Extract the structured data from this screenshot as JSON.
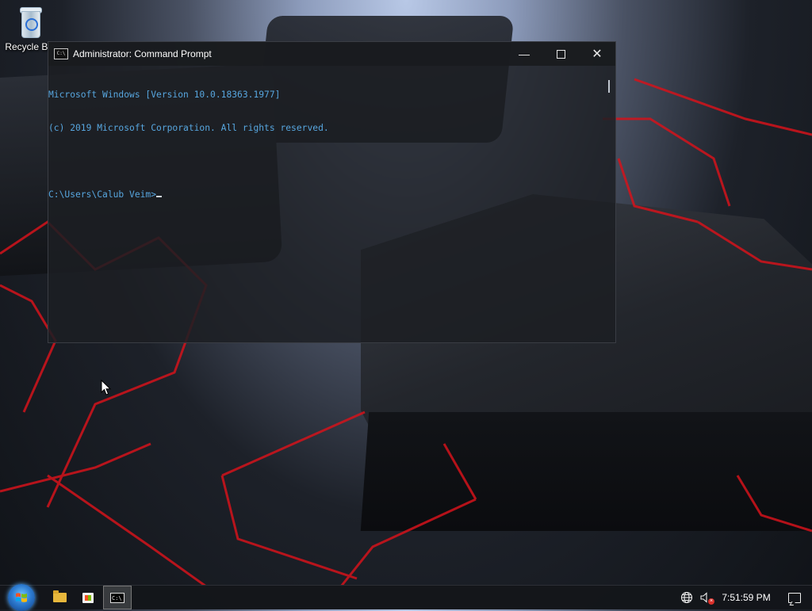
{
  "desktop": {
    "icons": [
      {
        "label": "Recycle Bin",
        "icon": "recycle-bin-icon"
      }
    ]
  },
  "cmd_window": {
    "title": "Administrator: Command Prompt",
    "controls": {
      "minimize": "—",
      "maximize": "",
      "close": "✕"
    },
    "lines": [
      "Microsoft Windows [Version 10.0.18363.1977]",
      "(c) 2019 Microsoft Corporation. All rights reserved.",
      "",
      "C:\\Users\\Calub Veim>"
    ],
    "text_color": "#57a6df"
  },
  "taskbar": {
    "start_icon": "windows-start-orb",
    "pinned": [
      {
        "name": "file-explorer",
        "icon": "folder-icon"
      },
      {
        "name": "microsoft-store",
        "icon": "store-icon"
      },
      {
        "name": "command-prompt",
        "icon": "cmd-icon",
        "active": true
      }
    ],
    "tray": {
      "network_icon": "globe-icon",
      "volume_icon": "speaker-muted-icon",
      "time": "7:51:59 PM",
      "notification_icon": "action-center-icon"
    }
  }
}
